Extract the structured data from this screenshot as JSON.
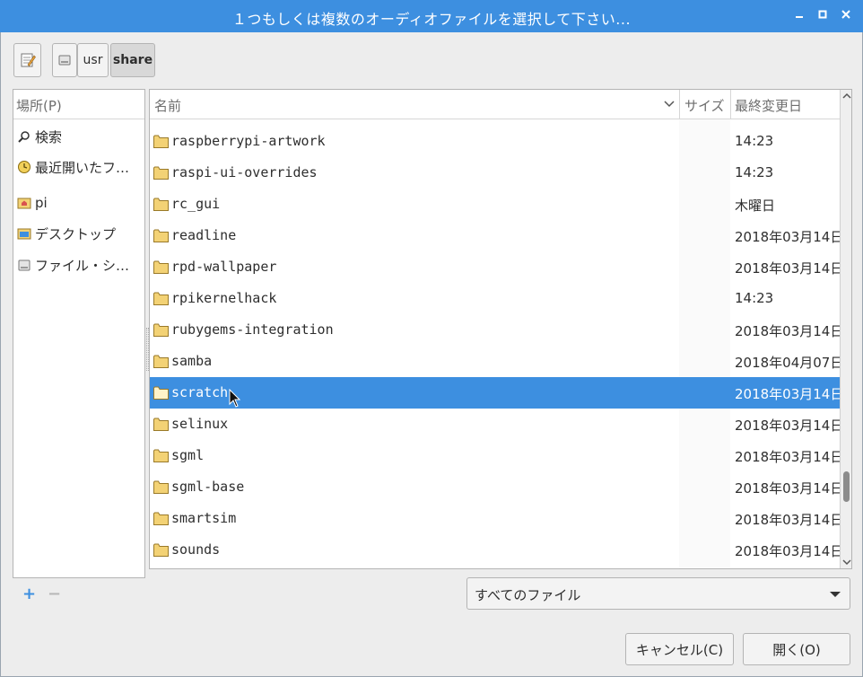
{
  "window": {
    "title": "１つもしくは複数のオーディオファイルを選択して下さい..."
  },
  "pathbar": {
    "crumbs": [
      "usr",
      "share"
    ],
    "active": "share"
  },
  "places": {
    "header": "場所(P)",
    "items": [
      {
        "label": "検索",
        "icon": "search-icon"
      },
      {
        "label": "最近開いたフ…",
        "icon": "recent-icon"
      },
      {
        "label": "pi",
        "icon": "home-folder-icon"
      },
      {
        "label": "デスクトップ",
        "icon": "desktop-icon"
      },
      {
        "label": "ファイル・シ…",
        "icon": "drive-icon"
      }
    ]
  },
  "columns": {
    "name": "名前",
    "size": "サイズ",
    "modified": "最終変更日"
  },
  "files": [
    {
      "name": "raspberrypi-artwork",
      "modified": "14:23"
    },
    {
      "name": "raspi-ui-overrides",
      "modified": "14:23"
    },
    {
      "name": "rc_gui",
      "modified": "木曜日"
    },
    {
      "name": "readline",
      "modified": "2018年03月14日"
    },
    {
      "name": "rpd-wallpaper",
      "modified": "2018年03月14日"
    },
    {
      "name": "rpikernelhack",
      "modified": "14:23"
    },
    {
      "name": "rubygems-integration",
      "modified": "2018年03月14日"
    },
    {
      "name": "samba",
      "modified": "2018年04月07日"
    },
    {
      "name": "scratch",
      "modified": "2018年03月14日",
      "selected": true
    },
    {
      "name": "selinux",
      "modified": "2018年03月14日"
    },
    {
      "name": "sgml",
      "modified": "2018年03月14日"
    },
    {
      "name": "sgml-base",
      "modified": "2018年03月14日"
    },
    {
      "name": "smartsim",
      "modified": "2018年03月14日"
    },
    {
      "name": "sounds",
      "modified": "2018年03月14日"
    }
  ],
  "places_actions": {
    "add": "+",
    "remove": "−"
  },
  "filter": {
    "selected": "すべてのファイル"
  },
  "buttons": {
    "cancel": "キャンセル(C)",
    "open": "開く(O)"
  },
  "colors": {
    "accent": "#3d8fe0",
    "folder": "#f3d275"
  }
}
